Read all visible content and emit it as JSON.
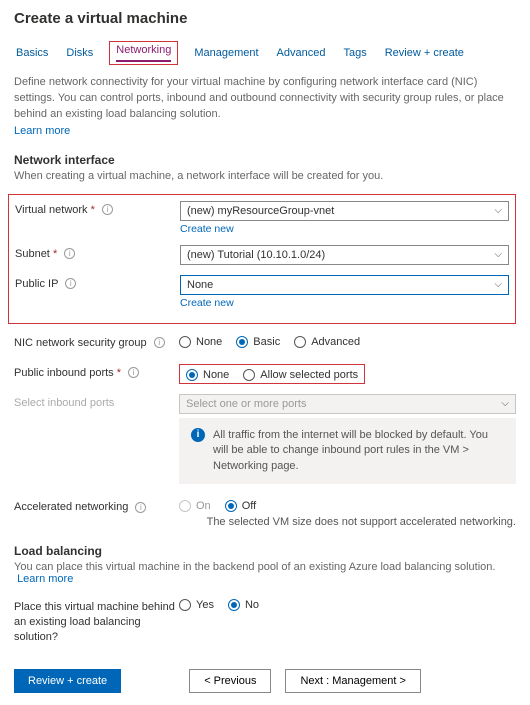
{
  "title": "Create a virtual machine",
  "tabs": {
    "basics": "Basics",
    "disks": "Disks",
    "networking": "Networking",
    "management": "Management",
    "advanced": "Advanced",
    "tags": "Tags",
    "review": "Review + create"
  },
  "intro": "Define network connectivity for your virtual machine by configuring network interface card (NIC) settings. You can control ports, inbound and outbound connectivity with security group rules, or place behind an existing load balancing solution.",
  "learn_more": "Learn more",
  "sections": {
    "net_iface": "Network interface",
    "net_iface_sub": "When creating a virtual machine, a network interface will be created for you.",
    "load_bal": "Load balancing",
    "load_bal_sub": "You can place this virtual machine in the backend pool of an existing Azure load balancing solution."
  },
  "fields": {
    "vnet": {
      "label": "Virtual network",
      "value": "(new) myResourceGroup-vnet",
      "create": "Create new"
    },
    "subnet": {
      "label": "Subnet",
      "value": "(new) Tutorial (10.10.1.0/24)"
    },
    "pip": {
      "label": "Public IP",
      "value": "None",
      "create": "Create new"
    },
    "nsg": {
      "label": "NIC network security group",
      "none": "None",
      "basic": "Basic",
      "advanced": "Advanced"
    },
    "inbound": {
      "label": "Public inbound ports",
      "none": "None",
      "allow": "Allow selected ports"
    },
    "select_ports": {
      "label": "Select inbound ports",
      "placeholder": "Select one or more ports"
    },
    "accel": {
      "label": "Accelerated networking",
      "on": "On",
      "off": "Off",
      "note": "The selected VM size does not support accelerated networking."
    },
    "lb": {
      "label": "Place this virtual machine behind an existing load balancing solution?",
      "yes": "Yes",
      "no": "No"
    }
  },
  "info_panel": "All traffic from the internet will be blocked by default. You will be able to change inbound port rules in the VM > Networking page.",
  "footer": {
    "review": "Review + create",
    "prev": "< Previous",
    "next": "Next : Management >"
  }
}
